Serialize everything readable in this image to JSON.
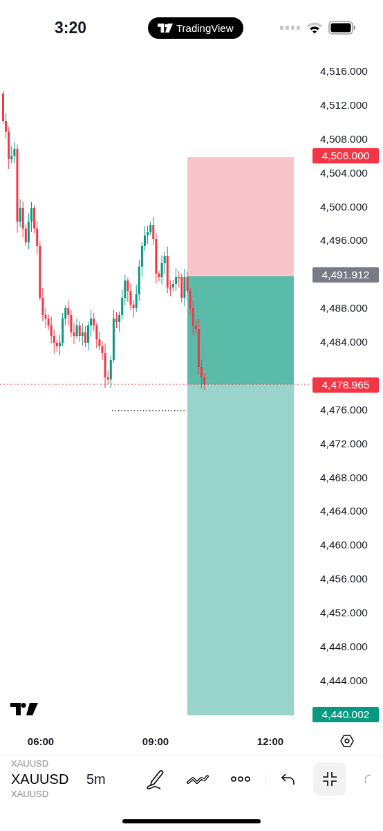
{
  "status_bar": {
    "time": "3:20",
    "app_pill": "TradingView"
  },
  "price_axis": {
    "labels": [
      "4,516.000",
      "4,512.000",
      "4,508.000",
      "4,504.000",
      "4,500.000",
      "4,496.000",
      "4,488.000",
      "4,484.000",
      "4,476.000",
      "4,472.000",
      "4,468.000",
      "4,464.000",
      "4,460.000",
      "4,456.000",
      "4,452.000",
      "4,448.000",
      "4,444.000"
    ]
  },
  "price_badges": [
    {
      "text": "4,506.000",
      "color": "#f23645"
    },
    {
      "text": "4,491.912",
      "color": "#787b86"
    },
    {
      "text": "4,478.965",
      "color": "#f23645"
    },
    {
      "text": "4,440.002",
      "color": "#089981"
    }
  ],
  "time_axis": {
    "labels": [
      "06:00",
      "09:00",
      "12:00"
    ]
  },
  "toolbar": {
    "symbols": [
      {
        "label": "XAUUSD",
        "selected": false
      },
      {
        "label": "XAUUSD",
        "selected": true
      },
      {
        "label": "XAUUSD",
        "selected": false
      }
    ],
    "interval": "5m"
  }
}
